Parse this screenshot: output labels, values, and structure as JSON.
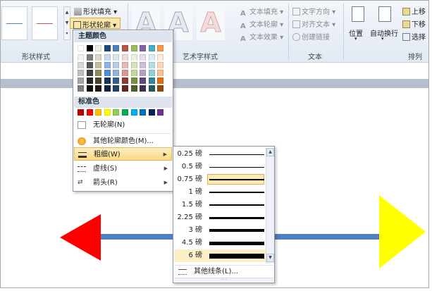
{
  "ribbon": {
    "shape_fill": "形状填充",
    "shape_outline": "形状轮廓",
    "group_shape_styles": "形状样式",
    "group_wordart": "艺术字样式",
    "text_fill": "文本填充",
    "text_outline": "文本轮廓",
    "text_effects": "文本效果",
    "text_direction": "文字方向",
    "align_text": "对齐文本",
    "create_link": "创建链接",
    "group_text": "文本",
    "position": "位置",
    "wrap_text": "自动换行",
    "bring_forward": "上移",
    "send_backward": "下移",
    "selection_pane": "选择",
    "group_arrange": "排列",
    "wordart_letter": "A"
  },
  "menu": {
    "theme_colors_header": "主题颜色",
    "standard_colors_header": "标准色",
    "no_outline": "无轮廓(N)",
    "more_colors": "其他轮廓颜色(M)...",
    "weight": "粗细(W)",
    "dashes": "虚线(S)",
    "arrows": "箭头(R)",
    "theme_base_colors": [
      "#ffffff",
      "#000000",
      "#eeece1",
      "#1f497d",
      "#4f81bd",
      "#c0504d",
      "#9bbb59",
      "#8064a2",
      "#4bacc6",
      "#f79646"
    ],
    "theme_tint_rows": [
      [
        "#f2f2f2",
        "#7f7f7f",
        "#ddd9c3",
        "#c6d9f0",
        "#dbe5f1",
        "#f2dcdb",
        "#ebf1dd",
        "#e5e0ec",
        "#dbeef3",
        "#fdeada"
      ],
      [
        "#d8d8d8",
        "#595959",
        "#c4bd97",
        "#8db3e2",
        "#b8cce4",
        "#e5b9b7",
        "#d7e3bc",
        "#ccc1d9",
        "#b7dde8",
        "#fbd5b5"
      ],
      [
        "#bfbfbf",
        "#3f3f3f",
        "#938953",
        "#548dd4",
        "#95b3d7",
        "#d99694",
        "#c3d69b",
        "#b2a2c7",
        "#92cddc",
        "#fac08f"
      ],
      [
        "#a5a5a5",
        "#262626",
        "#494429",
        "#17365d",
        "#366092",
        "#953734",
        "#76923c",
        "#5f497a",
        "#31859b",
        "#e36c09"
      ],
      [
        "#7f7f7f",
        "#0c0c0c",
        "#1d1b10",
        "#0f243e",
        "#244061",
        "#632423",
        "#4f6128",
        "#3f3151",
        "#205867",
        "#974806"
      ]
    ],
    "standard_colors": [
      "#c00000",
      "#ff0000",
      "#ffc000",
      "#ffff00",
      "#92d050",
      "#00b050",
      "#00b0f0",
      "#0070c0",
      "#002060",
      "#7030a0"
    ]
  },
  "weight_menu": {
    "items": [
      "0.25 磅",
      "0.5 磅",
      "0.75 磅",
      "1 磅",
      "1.5 磅",
      "2.25 磅",
      "3 磅",
      "4.5 磅",
      "6 磅"
    ],
    "selected_index": 8,
    "more_lines": "其他线条(L)..."
  },
  "slide": {
    "line_color": "#4f81bd",
    "left_arrow_color": "#ff0000",
    "right_arrow_color": "#ffff00"
  }
}
